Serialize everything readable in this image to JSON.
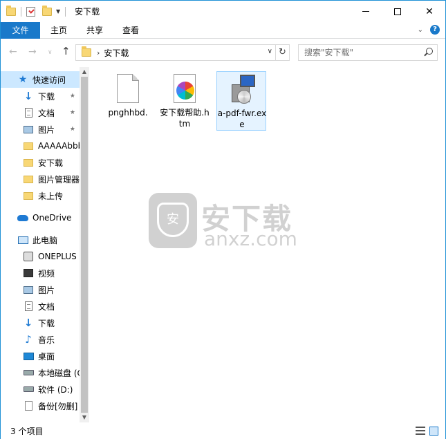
{
  "window": {
    "title": "安下载",
    "controls": {
      "minimize": "—",
      "maximize": "□",
      "close": "✕"
    }
  },
  "ribbon": {
    "tabs": [
      "文件",
      "主页",
      "共享",
      "查看"
    ],
    "help": "?"
  },
  "address": {
    "crumb": "安下载",
    "search_placeholder": "搜索\"安下载\""
  },
  "nav": {
    "items": [
      {
        "label": "快速访问",
        "icon": "star-icon"
      },
      {
        "label": "下载",
        "icon": "download-icon",
        "pinned": true
      },
      {
        "label": "文档",
        "icon": "document-icon",
        "pinned": true
      },
      {
        "label": "图片",
        "icon": "picture-icon",
        "pinned": true
      },
      {
        "label": "AAAAAbbb",
        "icon": "folder-icon"
      },
      {
        "label": "安下载",
        "icon": "folder-icon"
      },
      {
        "label": "图片管理器",
        "icon": "folder-icon"
      },
      {
        "label": "未上传",
        "icon": "folder-icon"
      },
      {
        "label": "OneDrive",
        "icon": "onedrive-icon"
      },
      {
        "label": "此电脑",
        "icon": "this-pc-icon"
      },
      {
        "label": "ONEPLUS",
        "icon": "phone-icon"
      },
      {
        "label": "视频",
        "icon": "video-icon"
      },
      {
        "label": "图片",
        "icon": "picture-icon"
      },
      {
        "label": "文档",
        "icon": "document-icon"
      },
      {
        "label": "下载",
        "icon": "download-icon"
      },
      {
        "label": "音乐",
        "icon": "music-icon"
      },
      {
        "label": "桌面",
        "icon": "desktop-icon"
      },
      {
        "label": "本地磁盘 (C:)",
        "icon": "drive-icon"
      },
      {
        "label": "软件 (D:)",
        "icon": "drive-icon"
      },
      {
        "label": "备份[勿删]",
        "icon": "file-icon"
      }
    ]
  },
  "files": [
    {
      "name": "pnghhbd.",
      "icon": "blank-file-icon"
    },
    {
      "name": "安下载帮助.htm",
      "icon": "htm-file-icon"
    },
    {
      "name": "a-pdf-fwr.exe",
      "icon": "setup-exe-icon",
      "selected": true
    }
  ],
  "watermark": {
    "cn": "安下载",
    "en": "anxz.com",
    "badge": "安"
  },
  "status": {
    "count": "3 个项目"
  }
}
